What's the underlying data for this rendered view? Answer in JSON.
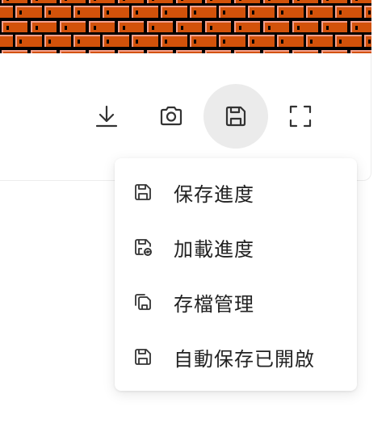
{
  "toolbar": {
    "buttons": [
      {
        "icon": "download-icon"
      },
      {
        "icon": "camera-icon"
      },
      {
        "icon": "save-floppy-icon",
        "active": true
      },
      {
        "icon": "fullscreen-icon"
      }
    ]
  },
  "save_menu": {
    "items": [
      {
        "icon": "floppy-disk-icon",
        "label": "保存進度"
      },
      {
        "icon": "floppy-load-icon",
        "label": "加載進度"
      },
      {
        "icon": "floppy-stack-icon",
        "label": "存檔管理"
      },
      {
        "icon": "floppy-disk-icon",
        "label": "自動保存已開啟"
      }
    ]
  },
  "colors": {
    "brick": "#d2520a",
    "brick_highlight": "#f4a08c",
    "mortar": "#000000",
    "icon": "#333333",
    "active_bg": "#ebebeb"
  }
}
